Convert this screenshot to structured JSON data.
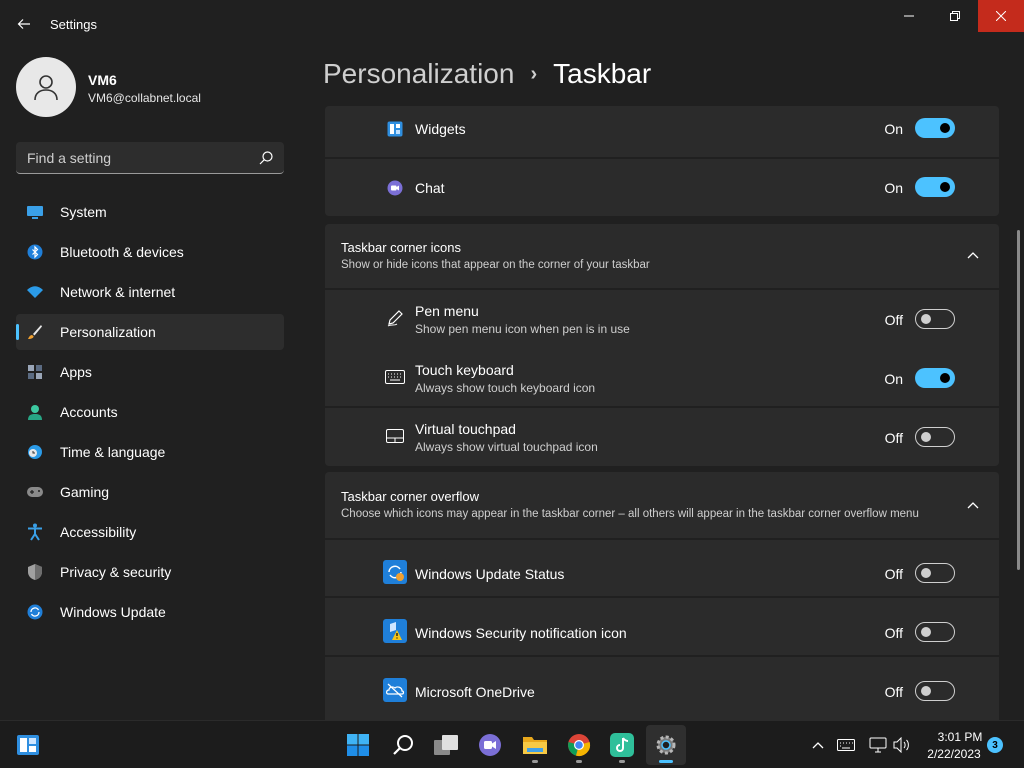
{
  "app": {
    "title": "Settings"
  },
  "user": {
    "name": "VM6",
    "email": "VM6@collabnet.local"
  },
  "search": {
    "placeholder": "Find a setting"
  },
  "nav": {
    "items": [
      {
        "label": "System",
        "icon": "monitor-icon"
      },
      {
        "label": "Bluetooth & devices",
        "icon": "bluetooth-icon"
      },
      {
        "label": "Network & internet",
        "icon": "wifi-icon"
      },
      {
        "label": "Personalization",
        "icon": "brush-icon",
        "active": true
      },
      {
        "label": "Apps",
        "icon": "apps-icon"
      },
      {
        "label": "Accounts",
        "icon": "person-icon"
      },
      {
        "label": "Time & language",
        "icon": "clock-globe-icon"
      },
      {
        "label": "Gaming",
        "icon": "gamepad-icon"
      },
      {
        "label": "Accessibility",
        "icon": "accessibility-icon"
      },
      {
        "label": "Privacy & security",
        "icon": "shield-icon"
      },
      {
        "label": "Windows Update",
        "icon": "update-icon"
      }
    ]
  },
  "header": {
    "parent": "Personalization",
    "separator": "›",
    "current": "Taskbar"
  },
  "items_top": [
    {
      "title": "Widgets",
      "state": "On",
      "on": true,
      "icon": "widgets-icon"
    },
    {
      "title": "Chat",
      "state": "On",
      "on": true,
      "icon": "chat-icon"
    }
  ],
  "corner_icons": {
    "title": "Taskbar corner icons",
    "description": "Show or hide icons that appear on the corner of your taskbar",
    "items": [
      {
        "title": "Pen menu",
        "description": "Show pen menu icon when pen is in use",
        "state": "Off",
        "on": false,
        "icon": "pen-icon"
      },
      {
        "title": "Touch keyboard",
        "description": "Always show touch keyboard icon",
        "state": "On",
        "on": true,
        "icon": "keyboard-icon"
      },
      {
        "title": "Virtual touchpad",
        "description": "Always show virtual touchpad icon",
        "state": "Off",
        "on": false,
        "icon": "touchpad-icon"
      }
    ]
  },
  "corner_overflow": {
    "title": "Taskbar corner overflow",
    "description": "Choose which icons may appear in the taskbar corner – all others will appear in the taskbar corner overflow menu",
    "items": [
      {
        "title": "Windows Update Status",
        "state": "Off",
        "on": false,
        "icon": "windows-update-status-icon"
      },
      {
        "title": "Windows Security notification icon",
        "state": "Off",
        "on": false,
        "icon": "windows-security-icon"
      },
      {
        "title": "Microsoft OneDrive",
        "state": "Off",
        "on": false,
        "icon": "onedrive-icon"
      }
    ]
  },
  "taskbar": {
    "time": "3:01 PM",
    "date": "2/22/2023",
    "notifications": "3"
  },
  "colors": {
    "accent": "#4cc2ff",
    "background": "#202020",
    "card": "#2b2b2b",
    "close": "#c42b1c"
  }
}
